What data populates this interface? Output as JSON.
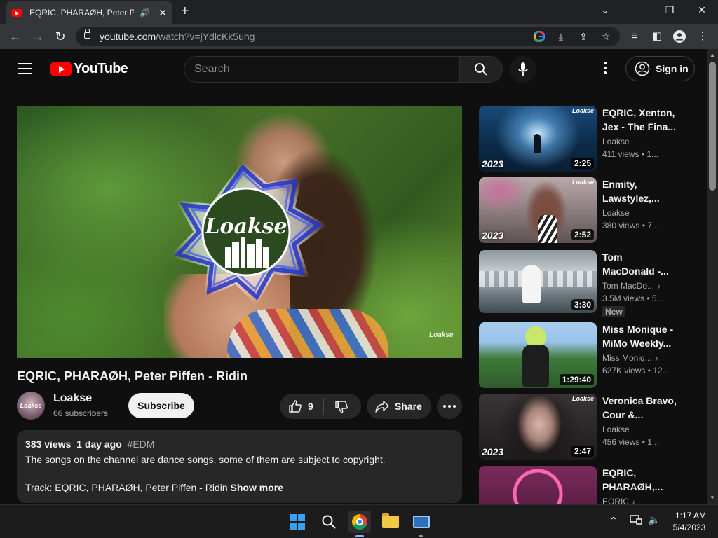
{
  "browser": {
    "tab_title": "EQRIC, PHARAØH, Peter Piffen - Ridin",
    "new_tab": "+",
    "url_host": "youtube.com",
    "url_path": "/watch?v=jYdlcKk5uhg"
  },
  "youtube": {
    "logo_text": "YouTube",
    "search_placeholder": "Search",
    "signin_label": "Sign in"
  },
  "video": {
    "title": "EQRIC, PHARAØH, Peter Piffen - Ridin",
    "overlay_logo": "Loakse",
    "watermark": "Loakse",
    "channel": "Loakse",
    "channel_avatar_text": "Loakse",
    "subscribers": "66 subscribers",
    "subscribe_label": "Subscribe",
    "likes": "9",
    "share_label": "Share",
    "description": {
      "views": "383 views",
      "age": "1 day ago",
      "tag": "#EDM",
      "line1": "The songs on the channel are dance songs, some of them are subject to copyright.",
      "track": "Track: EQRIC, PHARAØH, Peter Piffen - Ridin",
      "show_more": "Show more"
    }
  },
  "recommendations": [
    {
      "title_l1": "EQRIC, Xenton,",
      "title_l2": "Jex - The Fina...",
      "channel": "Loakse",
      "views": "411 views • 1...",
      "duration": "2:25",
      "year": "2023",
      "brand": "Loakse",
      "colors": [
        "#0b2a48",
        "#4e9fd4"
      ]
    },
    {
      "title_l1": "Enmity,",
      "title_l2": "Lawstylez,...",
      "channel": "Loakse",
      "views": "380 views • 7...",
      "duration": "2:52",
      "year": "2023",
      "brand": "Loakse",
      "colors": [
        "#6b5a58",
        "#d9c5c8"
      ]
    },
    {
      "title_l1": "Tom",
      "title_l2": "MacDonald -...",
      "channel": "Tom MacDo...",
      "views": "3.5M views • 5...",
      "duration": "3:30",
      "badge": "New",
      "colors": [
        "#3d4a52",
        "#b9c2c8"
      ]
    },
    {
      "title_l1": "Miss Monique -",
      "title_l2": "MiMo Weekly...",
      "channel": "Miss Moniq...",
      "views": "627K views • 12...",
      "duration": "1:29:40",
      "colors": [
        "#2f5a2c",
        "#9ac2e8"
      ]
    },
    {
      "title_l1": "Veronica Bravo,",
      "title_l2": "Cour &...",
      "channel": "Loakse",
      "views": "456 views • 1...",
      "duration": "2:47",
      "year": "2023",
      "brand": "Loakse",
      "colors": [
        "#141414",
        "#6a5a5c"
      ]
    },
    {
      "title_l1": "EQRIC,",
      "title_l2": "PHARAØH,...",
      "channel": "EQRIC",
      "colors": [
        "#4a1a3a",
        "#e84fa0"
      ]
    }
  ],
  "taskbar": {
    "time": "1:17 AM",
    "date": "5/4/2023"
  }
}
